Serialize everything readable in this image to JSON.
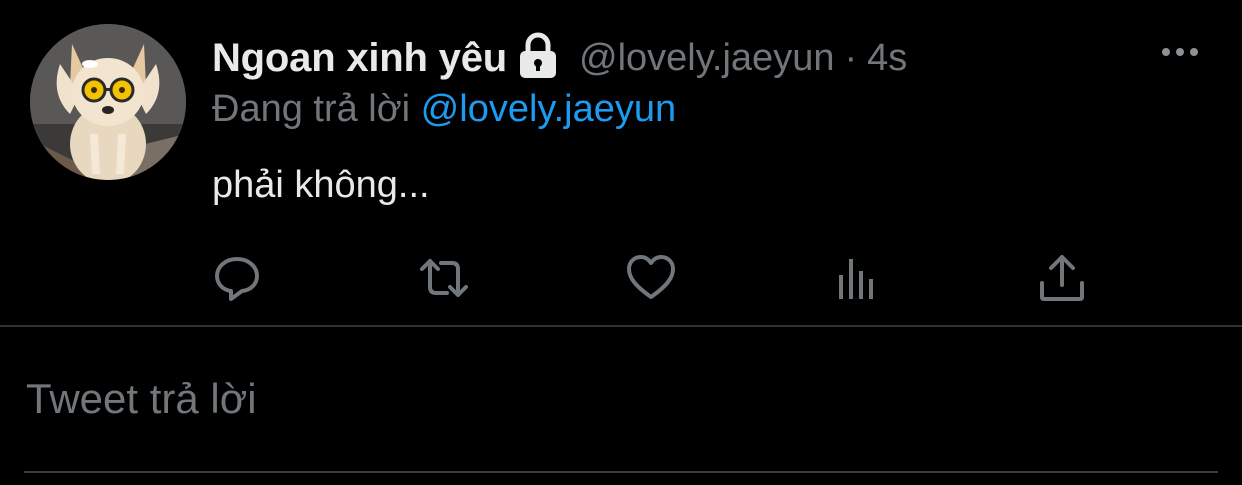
{
  "tweet": {
    "display_name": "Ngoan xinh yêu",
    "handle": "@lovely.jaeyun",
    "separator": "·",
    "time": "4s",
    "reply_prefix": "Đang trả lời",
    "reply_to": "@lovely.jaeyun",
    "text": "phải không...",
    "avatar_icon": "dog-with-sunglasses-avatar",
    "lock_icon": "lock-icon",
    "more_icon": "more-horizontal-icon"
  },
  "actions": [
    {
      "name": "reply",
      "icon": "reply-icon"
    },
    {
      "name": "retweet",
      "icon": "retweet-icon"
    },
    {
      "name": "like",
      "icon": "heart-icon"
    },
    {
      "name": "analytics",
      "icon": "analytics-icon"
    },
    {
      "name": "share",
      "icon": "share-icon"
    }
  ],
  "composer": {
    "placeholder": "Tweet trả lời"
  },
  "colors": {
    "background": "#000000",
    "primary_text": "#e7e9ea",
    "secondary_text": "#71767b",
    "accent": "#1d9bf0",
    "divider": "#2f3336"
  }
}
